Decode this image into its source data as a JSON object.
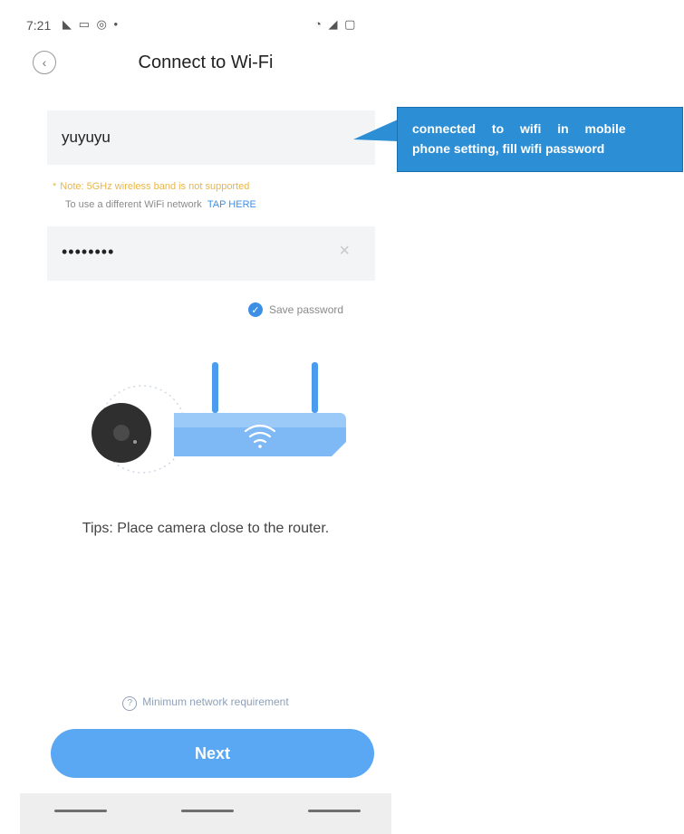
{
  "status_bar": {
    "time": "7:21",
    "left_icons": "◣ ▭ ◎ •",
    "right_icons": "◔ ◢ ▢"
  },
  "header": {
    "title": "Connect to Wi-Fi",
    "back_icon": "‹"
  },
  "wifi": {
    "ssid": "yuyuyu",
    "note": "Note: 5GHz wireless band is not supported",
    "hint_text": "To use a different WiFi network",
    "hint_link": "TAP HERE",
    "password_masked": "••••••••",
    "clear_icon": "×",
    "save_password_label": "Save password",
    "save_checked": true
  },
  "tips": "Tips: Place camera close to the router.",
  "min_requirement": "Minimum network requirement",
  "next_button": "Next",
  "callout": {
    "line1": "connected to wifi in mobile",
    "line2": "phone setting, fill wifi password"
  },
  "colors": {
    "accent": "#5aa8f3",
    "link": "#3d8fe6",
    "note": "#e8b64a",
    "callout": "#2c8fd6"
  }
}
